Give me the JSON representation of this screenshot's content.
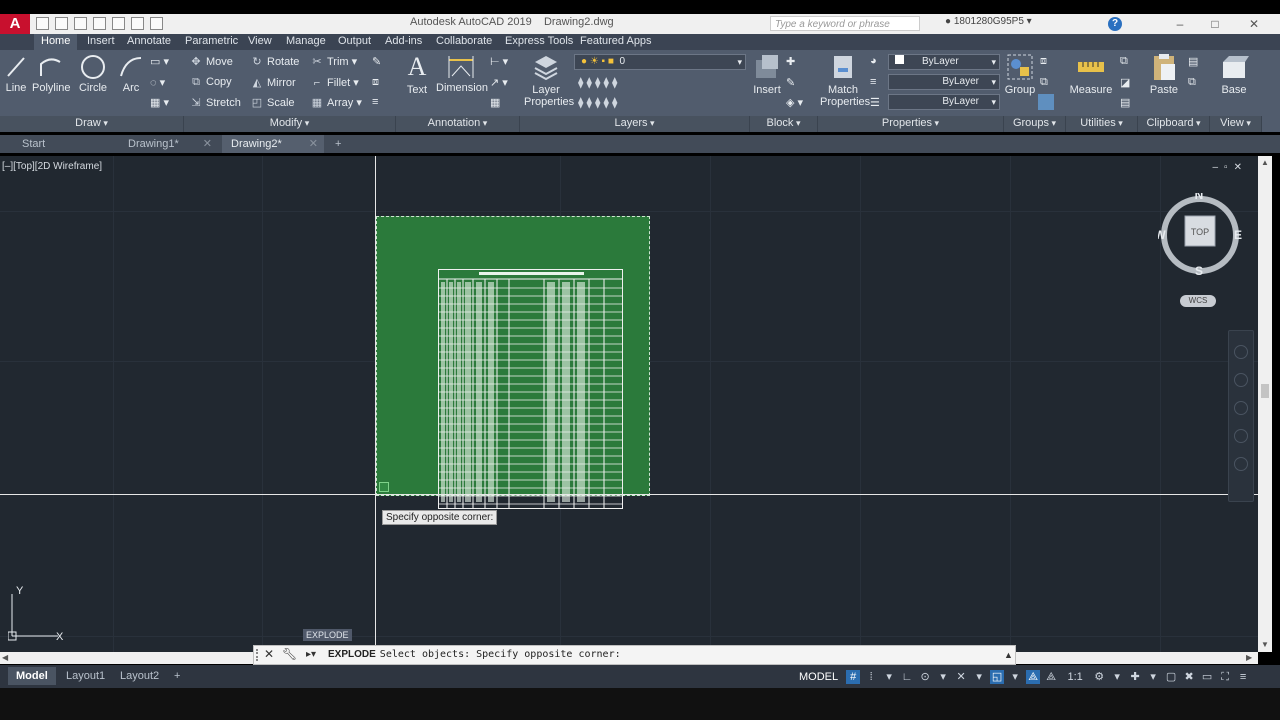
{
  "titlebar": {
    "app_title": "Autodesk AutoCAD 2019",
    "file_name": "Drawing2.dwg",
    "search_placeholder": "Type a keyword or phrase",
    "user_id": "1801280G95P5"
  },
  "ribbon_tabs": [
    "Home",
    "Insert",
    "Annotate",
    "Parametric",
    "View",
    "Manage",
    "Output",
    "Add-ins",
    "Collaborate",
    "Express Tools",
    "Featured Apps"
  ],
  "draw": {
    "line": "Line",
    "polyline": "Polyline",
    "circle": "Circle",
    "arc": "Arc",
    "panel": "Draw"
  },
  "modify": {
    "move": "Move",
    "rotate": "Rotate",
    "trim": "Trim",
    "copy": "Copy",
    "mirror": "Mirror",
    "fillet": "Fillet",
    "stretch": "Stretch",
    "scale": "Scale",
    "array": "Array",
    "panel": "Modify"
  },
  "annotation": {
    "text": "Text",
    "dimension": "Dimension",
    "panel": "Annotation"
  },
  "layers": {
    "layer_properties_line1": "Layer",
    "layer_properties_line2": "Properties",
    "current_layer": "0",
    "panel": "Layers"
  },
  "block": {
    "insert": "Insert",
    "panel": "Block"
  },
  "properties": {
    "match_line1": "Match",
    "match_line2": "Properties",
    "color": "ByLayer",
    "linetype": "ByLayer",
    "lineweight": "ByLayer",
    "panel": "Properties"
  },
  "groups": {
    "group": "Group",
    "panel": "Groups"
  },
  "utilities": {
    "measure": "Measure",
    "panel": "Utilities"
  },
  "clipboard": {
    "paste": "Paste",
    "panel": "Clipboard"
  },
  "view": {
    "base": "Base",
    "panel": "View"
  },
  "doc_tabs": {
    "start": "Start",
    "drawing1": "Drawing1*",
    "drawing2": "Drawing2*"
  },
  "viewport": {
    "label": "[–][Top][2D Wireframe]",
    "tooltip": "Specify opposite corner:",
    "command_label": "EXPLODE",
    "viewcube_top": "TOP",
    "compass_n": "N",
    "compass_s": "S",
    "compass_e": "E",
    "compass_w": "W",
    "wcs": "WCS",
    "ucs_x": "X",
    "ucs_y": "Y"
  },
  "command_line": {
    "command": "EXPLODE",
    "prompt": "Select objects: Specify opposite corner:"
  },
  "layout_tabs": [
    "Model",
    "Layout1",
    "Layout2"
  ],
  "status": {
    "model": "MODEL",
    "scale": "1:1"
  }
}
